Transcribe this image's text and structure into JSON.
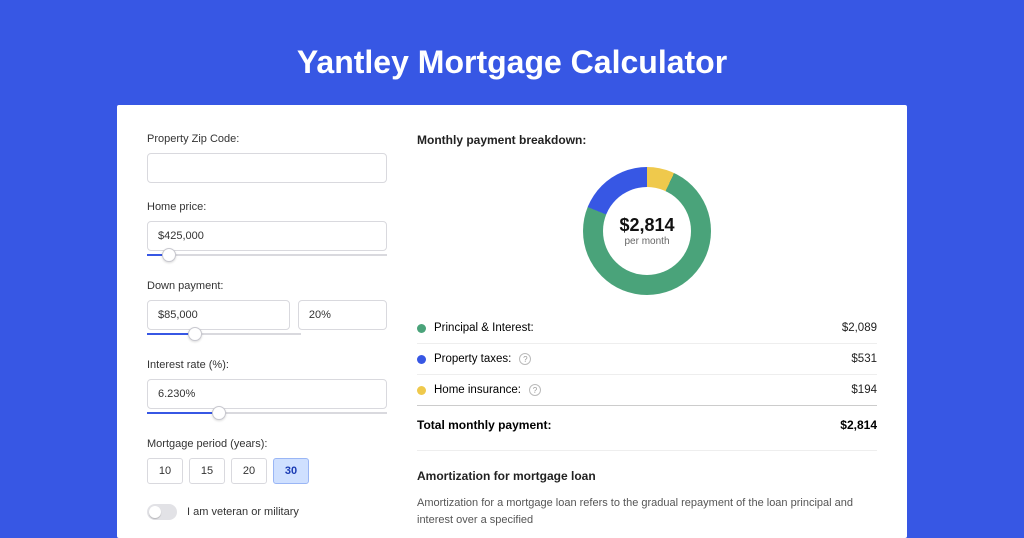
{
  "page_title": "Yantley Mortgage Calculator",
  "form": {
    "zip": {
      "label": "Property Zip Code:",
      "value": ""
    },
    "home_price": {
      "label": "Home price:",
      "value": "$425,000",
      "slider_percent": 9
    },
    "down_payment": {
      "label": "Down payment:",
      "amount": "$85,000",
      "percent": "20%",
      "slider_percent": 20
    },
    "interest": {
      "label": "Interest rate (%):",
      "value": "6.230%",
      "slider_percent": 30
    },
    "period": {
      "label": "Mortgage period (years):",
      "options": [
        "10",
        "15",
        "20",
        "30"
      ],
      "selected": "30"
    },
    "veteran": {
      "label": "I am veteran or military",
      "on": false
    }
  },
  "breakdown": {
    "title": "Monthly payment breakdown:",
    "donut": {
      "value": "$2,814",
      "sub": "per month"
    },
    "rows": [
      {
        "label": "Principal & Interest:",
        "value": "$2,089",
        "color": "green",
        "help": false
      },
      {
        "label": "Property taxes:",
        "value": "$531",
        "color": "blue",
        "help": true
      },
      {
        "label": "Home insurance:",
        "value": "$194",
        "color": "yellow",
        "help": true
      }
    ],
    "total": {
      "label": "Total monthly payment:",
      "value": "$2,814"
    }
  },
  "chart_data": {
    "type": "pie",
    "title": "Monthly payment breakdown",
    "series": [
      {
        "name": "Principal & Interest",
        "value": 2089,
        "color": "#4aa37a"
      },
      {
        "name": "Property taxes",
        "value": 531,
        "color": "#3757e4"
      },
      {
        "name": "Home insurance",
        "value": 194,
        "color": "#efc94c"
      }
    ],
    "center_label": "$2,814 per month",
    "total": 2814
  },
  "amortization": {
    "title": "Amortization for mortgage loan",
    "text": "Amortization for a mortgage loan refers to the gradual repayment of the loan principal and interest over a specified"
  }
}
